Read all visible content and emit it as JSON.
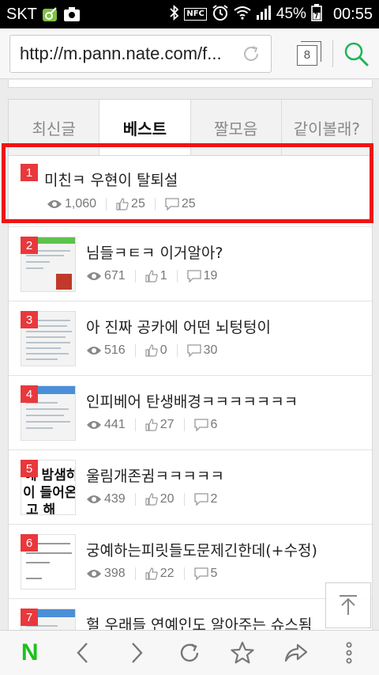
{
  "status_bar": {
    "carrier": "SKT",
    "battery": "45%",
    "time": "00:55",
    "nfc_label": "NFC"
  },
  "browser": {
    "url": "http://m.pann.nate.com/f...",
    "tab_count": "8"
  },
  "tabs": [
    {
      "label": "최신글",
      "active": false
    },
    {
      "label": "베스트",
      "active": true
    },
    {
      "label": "짤모음",
      "active": false
    },
    {
      "label": "같이볼래?",
      "active": false
    }
  ],
  "posts": [
    {
      "rank": "1",
      "title": "미친ㅋ 우현이 탈퇴설",
      "views": "1,060",
      "likes": "25",
      "comments": "25",
      "has_thumbnail": false
    },
    {
      "rank": "2",
      "title": "님들ㅋㅌㅋ 이거알아?",
      "views": "671",
      "likes": "1",
      "comments": "19",
      "has_thumbnail": true
    },
    {
      "rank": "3",
      "title": "아 진짜 공카에 어떤 뇌텅텅이",
      "views": "516",
      "likes": "0",
      "comments": "30",
      "has_thumbnail": true
    },
    {
      "rank": "4",
      "title": "인피베어 탄생배경ㅋㅋㅋㅋㅋㅋㅋ",
      "views": "441",
      "likes": "27",
      "comments": "6",
      "has_thumbnail": true
    },
    {
      "rank": "5",
      "title": "울림개존귐ㅋㅋㅋㅋㅋ",
      "views": "439",
      "likes": "20",
      "comments": "2",
      "has_thumbnail": true,
      "thumb_text": [
        "에 밤샘하",
        "이 들어온다",
        "고 해"
      ]
    },
    {
      "rank": "6",
      "title": "궁예하는피릿들도문제긴한데(+수정)",
      "views": "398",
      "likes": "22",
      "comments": "5",
      "has_thumbnail": true
    },
    {
      "rank": "7",
      "title": "헐 우래들 연예인도 알아주는 슈스됨",
      "views": "",
      "likes": "",
      "comments": "",
      "has_thumbnail": true
    }
  ],
  "colors": {
    "rank_badge": "#e8383d",
    "highlight": "#f01414",
    "naver_green": "#1fc01f",
    "search_green": "#1fb45a"
  }
}
